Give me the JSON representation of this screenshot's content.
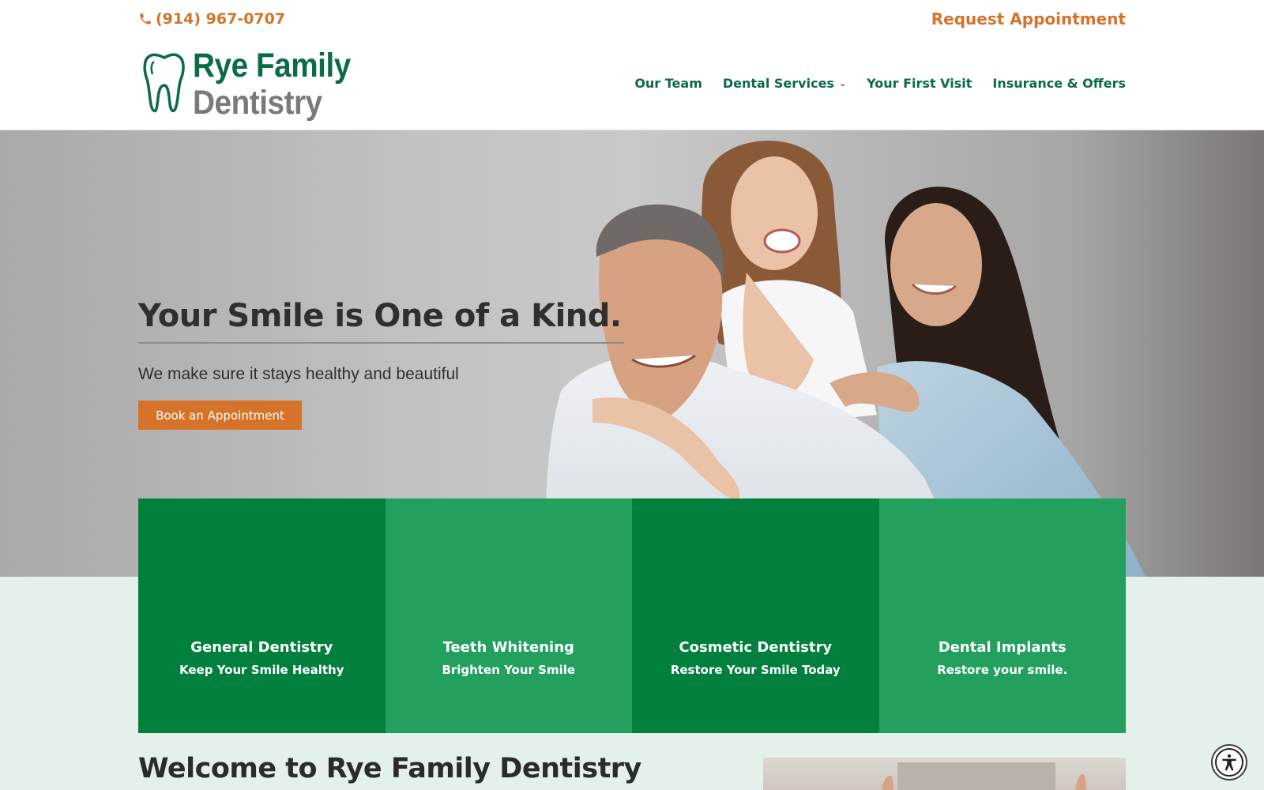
{
  "topbar": {
    "phone": "(914) 967-0707",
    "request": "Request Appointment"
  },
  "logo": {
    "line1": "Rye Family",
    "line2": "Dentistry",
    "icon": "tooth-icon"
  },
  "nav": {
    "items": [
      {
        "label": "Our Team"
      },
      {
        "label": "Dental Services",
        "has_dropdown": true
      },
      {
        "label": "Your First Visit"
      },
      {
        "label": "Insurance & Offers"
      }
    ]
  },
  "hero": {
    "title": "Your Smile is One of a Kind.",
    "subtitle": "We make sure it stays healthy and beautiful",
    "button": "Book an Appointment"
  },
  "services": [
    {
      "title": "General Dentistry",
      "subtitle": "Keep Your Smile Healthy"
    },
    {
      "title": "Teeth Whitening",
      "subtitle": "Brighten Your Smile"
    },
    {
      "title": "Cosmetic Dentistry",
      "subtitle": "Restore Your Smile Today"
    },
    {
      "title": "Dental Implants",
      "subtitle": "Restore your smile."
    }
  ],
  "welcome": {
    "heading": "Welcome to Rye Family Dentistry"
  },
  "colors": {
    "orange": "#d5732a",
    "green_dark": "#017f3c",
    "green_light": "#23a05d",
    "brand_green": "#0b6b45",
    "mint": "#e3f0eb"
  }
}
